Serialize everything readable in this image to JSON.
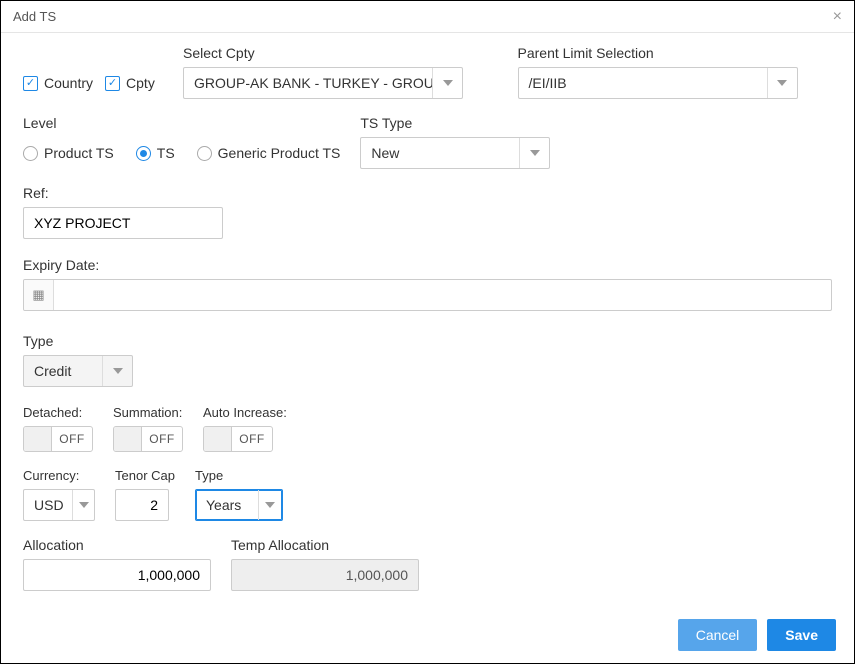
{
  "header": {
    "title": "Add TS"
  },
  "top": {
    "checkboxes": {
      "country": {
        "label": "Country",
        "checked": true
      },
      "cpty": {
        "label": "Cpty",
        "checked": true
      }
    },
    "select_cpty": {
      "label": "Select Cpty",
      "value": "GROUP-AK BANK - TURKEY - GROUP"
    },
    "parent_limit": {
      "label": "Parent Limit Selection",
      "value": "/EI/IIB"
    }
  },
  "level": {
    "label": "Level",
    "opts": {
      "product_ts": {
        "label": "Product TS",
        "selected": false
      },
      "ts": {
        "label": "TS",
        "selected": true
      },
      "generic": {
        "label": "Generic Product TS",
        "selected": false
      }
    }
  },
  "ts_type": {
    "label": "TS Type",
    "value": "New"
  },
  "ref": {
    "label": "Ref:",
    "value": "XYZ PROJECT"
  },
  "expiry": {
    "label": "Expiry Date:",
    "value": ""
  },
  "type": {
    "label": "Type",
    "value": "Credit"
  },
  "toggles": {
    "detached": {
      "label": "Detached:",
      "state": "OFF"
    },
    "summation": {
      "label": "Summation:",
      "state": "OFF"
    },
    "auto_inc": {
      "label": "Auto Increase:",
      "state": "OFF"
    }
  },
  "currency": {
    "label": "Currency:",
    "value": "USD"
  },
  "tenor_cap": {
    "label": "Tenor Cap",
    "value": "2"
  },
  "tenor_type": {
    "label": "Type",
    "value": "Years"
  },
  "allocation": {
    "label": "Allocation",
    "value": "1,000,000"
  },
  "temp_allocation": {
    "label": "Temp Allocation",
    "value": "1,000,000"
  },
  "footer": {
    "cancel": "Cancel",
    "save": "Save"
  }
}
